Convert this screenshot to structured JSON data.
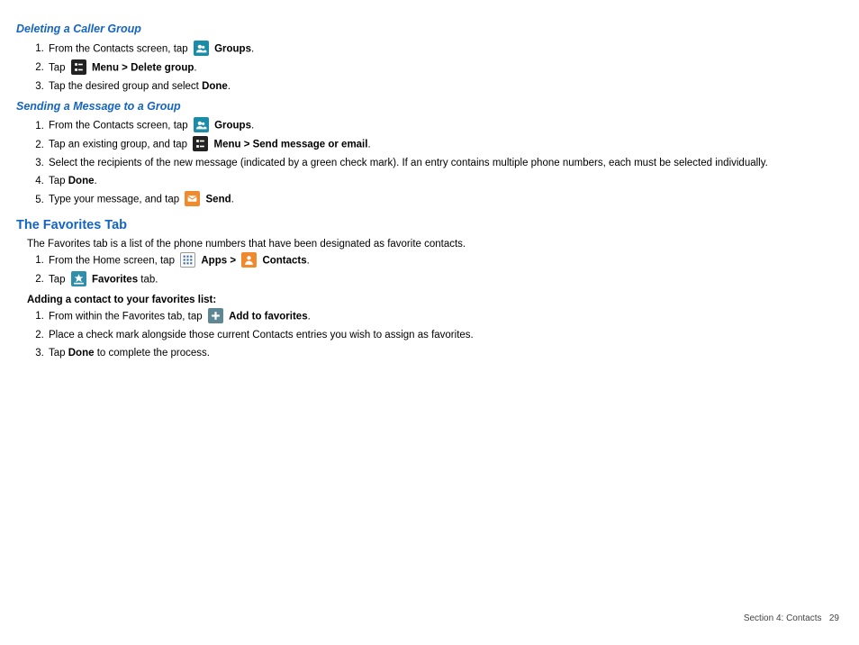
{
  "sections": {
    "deleting": {
      "title": "Deleting a Caller Group",
      "steps": {
        "s1a": "From the Contacts screen, tap ",
        "s1b": "Groups",
        "s2a": "Tap ",
        "s2b": "Menu > Delete group",
        "s3a": "Tap the desired group and select ",
        "s3b": "Done"
      }
    },
    "sending": {
      "title": "Sending a Message to a Group",
      "steps": {
        "s1a": "From the Contacts screen, tap ",
        "s1b": "Groups",
        "s2a": "Tap an existing group, and tap ",
        "s2b": "Menu > Send message or email",
        "s3": "Select the recipients of the new message (indicated by a green check mark). If an entry contains multiple phone numbers, each must be selected individually.",
        "s4a": "Tap ",
        "s4b": "Done",
        "s5a": "Type your message, and tap ",
        "s5b": "Send"
      }
    },
    "favorites": {
      "title": "The Favorites Tab",
      "intro": "The Favorites tab is a list of the phone numbers that have been designated as favorite contacts.",
      "steps": {
        "s1a": "From the Home screen, tap ",
        "s1b": "Apps > ",
        "s1c": "Contacts",
        "s2a": "Tap ",
        "s2b": "Favorites",
        "s2c": " tab."
      },
      "addLabel": "Adding a contact to your favorites list:",
      "addSteps": {
        "s1a": "From within the Favorites tab, tap ",
        "s1b": "Add to favorites",
        "s2": "Place a check mark alongside those current Contacts entries you wish to assign as favorites.",
        "s3a": "Tap ",
        "s3b": "Done",
        "s3c": " to complete the process."
      }
    }
  },
  "footer": {
    "section": "Section 4:  Contacts",
    "page": "29"
  }
}
